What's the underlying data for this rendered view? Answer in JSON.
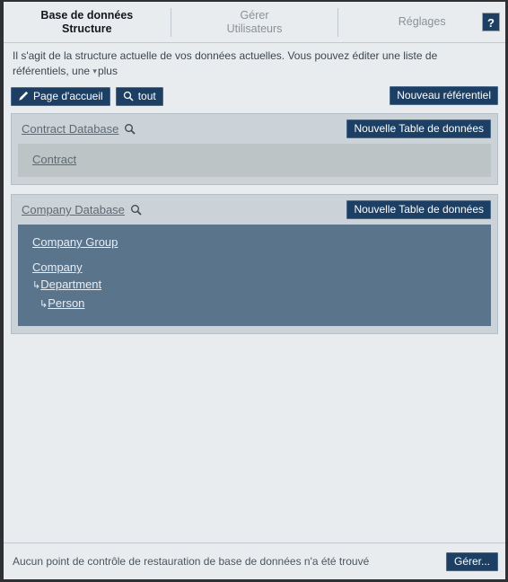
{
  "tabs": [
    {
      "line1": "Base de données",
      "line2": "Structure",
      "active": true
    },
    {
      "line1": "Gérer",
      "line2": "Utilisateurs",
      "active": false
    },
    {
      "line1": "Réglages",
      "line2": "",
      "active": false
    }
  ],
  "help_label": "?",
  "description": {
    "text": "Il s'agit de la structure actuelle de vos données actuelles. Vous pouvez éditer une liste de référentiels, une",
    "more_label": "plus",
    "chevron": "chevron-down-icon"
  },
  "toolbar": {
    "home_label": "Page d'accueil",
    "home_icon": "pencil-icon",
    "search_all_label": "tout",
    "search_icon": "search-icon",
    "new_repository_label": "Nouveau référentiel"
  },
  "sections": [
    {
      "title": "Contract Database",
      "search_icon": "search-icon",
      "new_table_label": "Nouvelle Table de données",
      "dark": false,
      "tables": [
        {
          "label": "Contract",
          "indent": 0,
          "arrow": false,
          "gap_before": false
        }
      ]
    },
    {
      "title": "Company Database",
      "search_icon": "search-icon",
      "new_table_label": "Nouvelle Table de données",
      "dark": true,
      "tables": [
        {
          "label": "Company Group",
          "indent": 0,
          "arrow": false,
          "gap_before": false
        },
        {
          "label": "Company",
          "indent": 0,
          "arrow": false,
          "gap_before": true
        },
        {
          "label": "Department",
          "indent": 1,
          "arrow": true,
          "gap_before": false
        },
        {
          "label": "Person",
          "indent": 2,
          "arrow": true,
          "gap_before": false
        }
      ]
    }
  ],
  "footer": {
    "message": "Aucun point de contrôle de restauration de base de données n'a été trouvé",
    "manage_label": "Gérer..."
  },
  "colors": {
    "accent": "#1c3f63",
    "page_bg": "#e9ecef",
    "section_bg": "#cbd2d8",
    "panel_light": "#bcc4c6",
    "panel_dark": "#5a748c",
    "link": "#5d6a76",
    "window_border": "#2e3033"
  }
}
